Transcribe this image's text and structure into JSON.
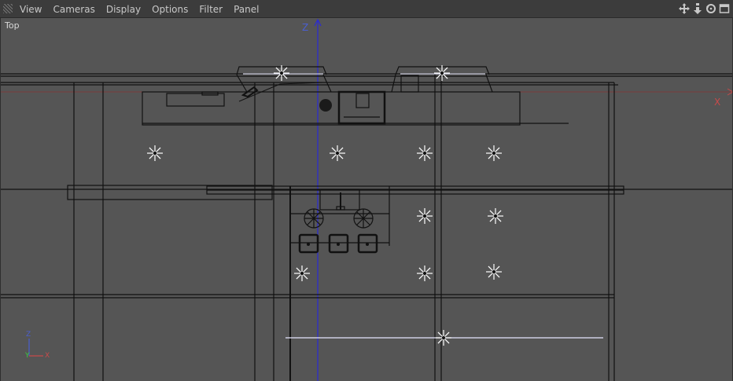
{
  "menubar": {
    "items": [
      {
        "label": "View"
      },
      {
        "label": "Cameras"
      },
      {
        "label": "Display"
      },
      {
        "label": "Options"
      },
      {
        "label": "Filter"
      },
      {
        "label": "Panel"
      }
    ],
    "nav_icons": [
      "move-icon",
      "zoom-icon",
      "rotate-icon",
      "maximize-icon"
    ]
  },
  "viewport": {
    "label": "Top",
    "axis_z": "Z",
    "axis_x": "X",
    "mini_axis": {
      "z": "Z",
      "y": "Y",
      "x": "X"
    }
  },
  "colors": {
    "background": "#555555",
    "menubar": "#3c3c3c",
    "wire": "#111111",
    "z_axis": "#2a2ad6",
    "x_axis": "#c84a4a",
    "light": "#ffffff"
  }
}
